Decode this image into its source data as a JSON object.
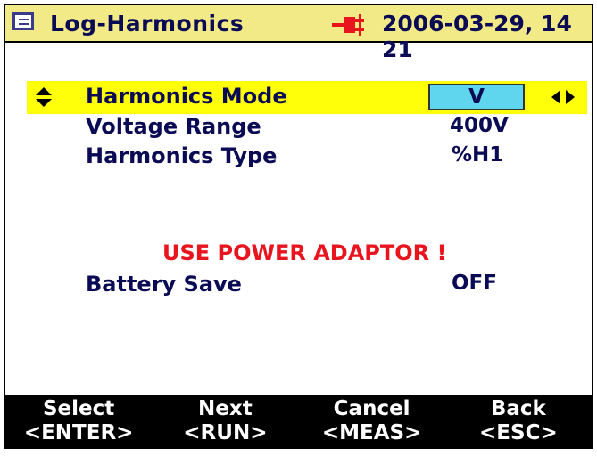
{
  "header": {
    "title": "Log-Harmonics",
    "datetime": "2006-03-29, 14 21",
    "menu_icon": "menu-icon",
    "power_icon": "plug-icon"
  },
  "settings": {
    "harmonics_mode": {
      "label": "Harmonics Mode",
      "value": "V"
    },
    "voltage_range": {
      "label": "Voltage Range",
      "value": "400V"
    },
    "harmonics_type": {
      "label": "Harmonics Type",
      "value": "%H1"
    }
  },
  "warning": "USE POWER ADAPTOR !",
  "battery_save": {
    "label": "Battery Save",
    "value": "OFF"
  },
  "softkeys": [
    {
      "label": "Select",
      "key": "<ENTER>"
    },
    {
      "label": "Next",
      "key": "<RUN>"
    },
    {
      "label": "Cancel",
      "key": "<MEAS>"
    },
    {
      "label": "Back",
      "key": "<ESC>"
    }
  ],
  "colors": {
    "header_bg": "#f2ea87",
    "highlight": "#ffff0a",
    "value_box": "#5fd6ee",
    "text": "#0a0a55",
    "warning": "#e8141e",
    "footer_bg": "#000000"
  }
}
